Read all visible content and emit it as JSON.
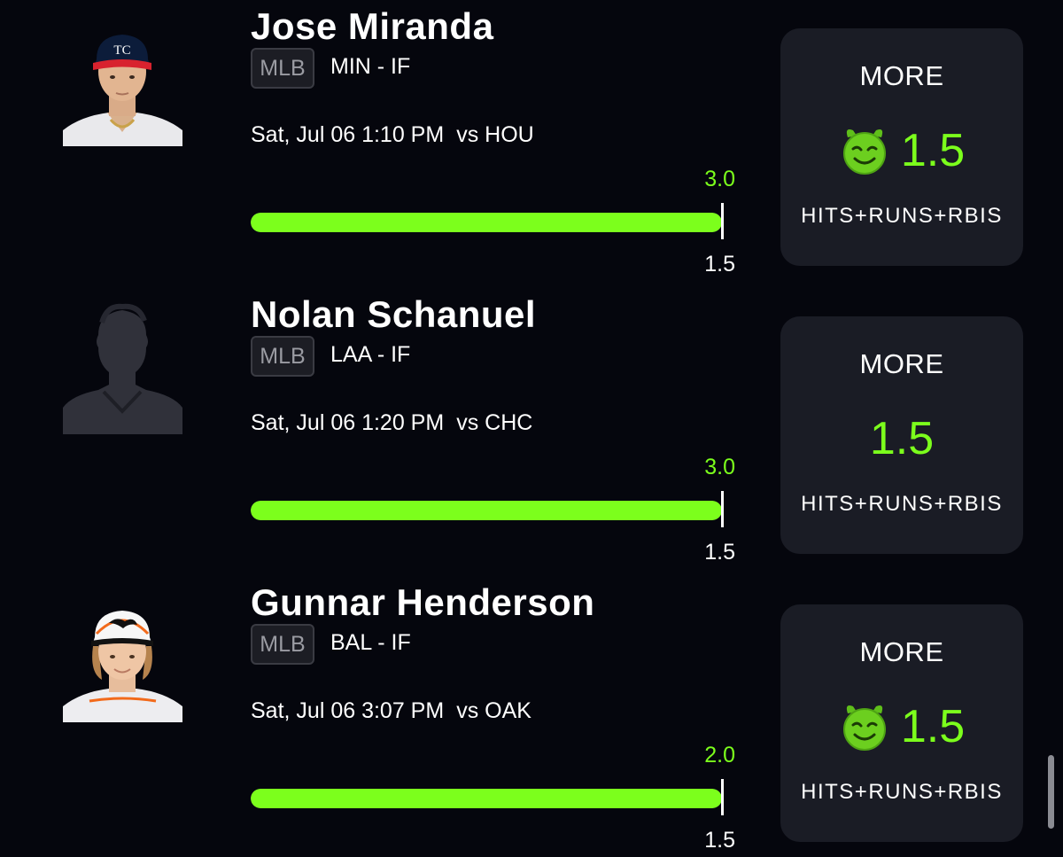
{
  "players": [
    {
      "name": "Jose Miranda",
      "league": "MLB",
      "team_pos": "MIN - IF",
      "game_time": "Sat, Jul 06 1:10 PM",
      "opponent": "vs HOU",
      "actual": "3.0",
      "line": "1.5",
      "progress": 1.0,
      "avatar": "player-photo-twins",
      "pick": {
        "direction": "MORE",
        "value": "1.5",
        "icon": "demon-emoji-icon",
        "stat": "HITS+RUNS+RBIS"
      }
    },
    {
      "name": "Nolan Schanuel",
      "league": "MLB",
      "team_pos": "LAA - IF",
      "game_time": "Sat, Jul 06 1:20 PM",
      "opponent": "vs CHC",
      "actual": "3.0",
      "line": "1.5",
      "progress": 1.0,
      "avatar": "placeholder-silhouette",
      "pick": {
        "direction": "MORE",
        "value": "1.5",
        "icon": "",
        "stat": "HITS+RUNS+RBIS"
      }
    },
    {
      "name": "Gunnar Henderson",
      "league": "MLB",
      "team_pos": "BAL - IF",
      "game_time": "Sat, Jul 06 3:07 PM",
      "opponent": "vs OAK",
      "actual": "2.0",
      "line": "1.5",
      "progress": 1.0,
      "avatar": "player-photo-orioles",
      "pick": {
        "direction": "MORE",
        "value": "1.5",
        "icon": "demon-emoji-icon",
        "stat": "HITS+RUNS+RBIS"
      }
    }
  ],
  "colors": {
    "background": "#05060d",
    "card": "#1a1c25",
    "accent_green": "#7cff1c",
    "badge_border": "#3a3b43"
  }
}
